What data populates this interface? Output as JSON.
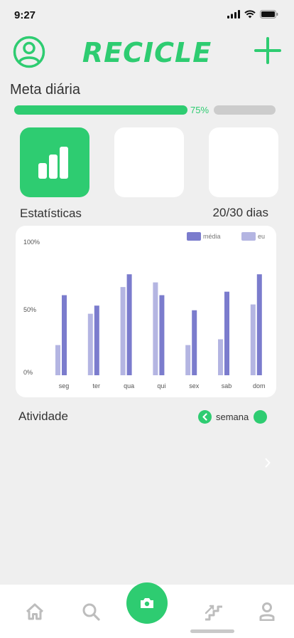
{
  "status": {
    "time": "9:27"
  },
  "header": {
    "title": "RECICLE"
  },
  "goal": {
    "title": "Meta diária",
    "percent_label": "75%",
    "progress": 0.75
  },
  "stats": {
    "label": "Estatísticas",
    "count": "20/30 dias"
  },
  "chart_data": {
    "type": "bar",
    "categories": [
      "seg",
      "ter",
      "qua",
      "qui",
      "sex",
      "sab",
      "dom"
    ],
    "series": [
      {
        "name": "média",
        "color": "#7b7ccd",
        "values": [
          69,
          60,
          87,
          69,
          56,
          72,
          87
        ]
      },
      {
        "name": "eu",
        "color": "#b4b5e2",
        "values": [
          26,
          53,
          76,
          80,
          26,
          31,
          61
        ]
      }
    ],
    "yticks": [
      "100%",
      "50%",
      "0%"
    ],
    "ylim": [
      0,
      100
    ],
    "legend": "top-right"
  },
  "activity": {
    "label": "Atividade",
    "period_label": "semana"
  },
  "colors": {
    "accent": "#2ecc71",
    "bar_primary": "#7b7ccd",
    "bar_secondary": "#b4b5e2"
  },
  "icons": {
    "profile": "user-circle-icon",
    "add": "plus-icon",
    "stats_tile": "bar-chart-icon",
    "prev": "chevron-left-icon",
    "next": "chevron-right-icon",
    "tabs": [
      "home-icon",
      "search-icon",
      "camera-icon",
      "stairs-icon",
      "person-icon"
    ]
  }
}
